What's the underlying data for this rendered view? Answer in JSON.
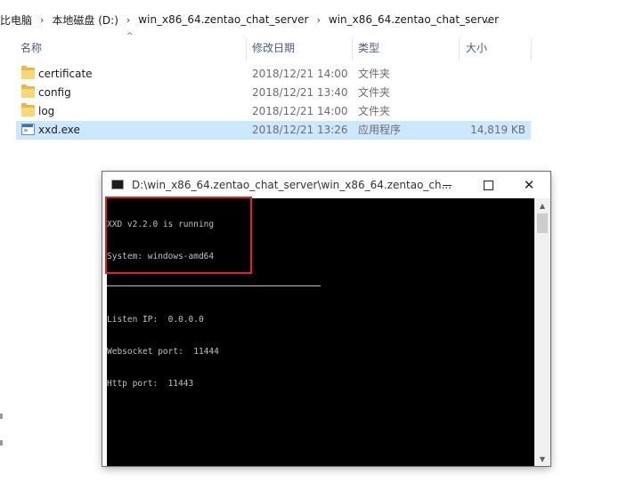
{
  "breadcrumb": {
    "items": [
      "比电脑",
      "本地磁盘 (D:)",
      "win_x86_64.zentao_chat_server",
      "win_x86_64.zentao_chat_server"
    ],
    "separator": "›",
    "dropdown": "⌄"
  },
  "columns": {
    "name": "名称",
    "date": "修改日期",
    "type": "类型",
    "size": "大小",
    "sort_indicator": "^"
  },
  "files": [
    {
      "name": "certificate",
      "date": "2018/12/21 14:00",
      "type": "文件夹",
      "size": "",
      "icon": "folder-icon"
    },
    {
      "name": "config",
      "date": "2018/12/21 13:40",
      "type": "文件夹",
      "size": "",
      "icon": "folder-icon"
    },
    {
      "name": "log",
      "date": "2018/12/21 14:00",
      "type": "文件夹",
      "size": "",
      "icon": "folder-icon"
    },
    {
      "name": "xxd.exe",
      "date": "2018/12/21 13:26",
      "type": "应用程序",
      "size": "14,819 KB",
      "icon": "exe-icon",
      "selected": true
    }
  ],
  "console": {
    "title": "D:\\win_x86_64.zentao_chat_server\\win_x86_64.zentao_ch...",
    "lines": [
      "XXD v2.2.0 is running",
      "System: windows-amd64",
      "Listen IP:  0.0.0.0",
      "Websocket port:  11444",
      "Http port:  11443"
    ],
    "close_glyph": "✕",
    "highlight_color": "#e52222"
  },
  "colors": {
    "selection": "#cce8ff",
    "console_bg": "#000000",
    "console_text": "#c0c0c0",
    "header_text": "#4a5d80"
  }
}
